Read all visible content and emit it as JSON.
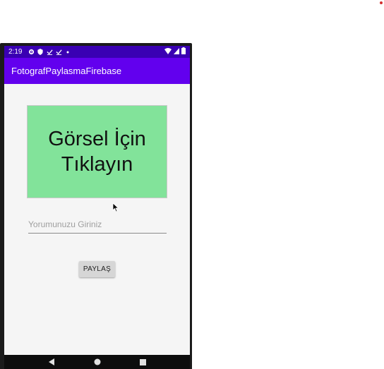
{
  "status_bar": {
    "time": "2:19"
  },
  "app_bar": {
    "title": "FotografPaylasmaFirebase"
  },
  "image_picker": {
    "line1": "Görsel İçin",
    "line2": "Tıklayın",
    "background_color": "#82e39a"
  },
  "comment_input": {
    "placeholder": "Yorumunuzu Giriniz",
    "value": ""
  },
  "share_button": {
    "label": "PAYLAŞ"
  },
  "colors": {
    "primary": "#6200ee",
    "status_bar": "#3a00b3"
  },
  "icons": {
    "status_left": [
      "settings-icon",
      "shield-icon",
      "download-done-icon",
      "download-done-icon",
      "dot-icon"
    ],
    "status_right": [
      "wifi-icon",
      "signal-icon",
      "battery-icon"
    ],
    "nav": [
      "back-icon",
      "home-icon",
      "recents-icon"
    ]
  }
}
